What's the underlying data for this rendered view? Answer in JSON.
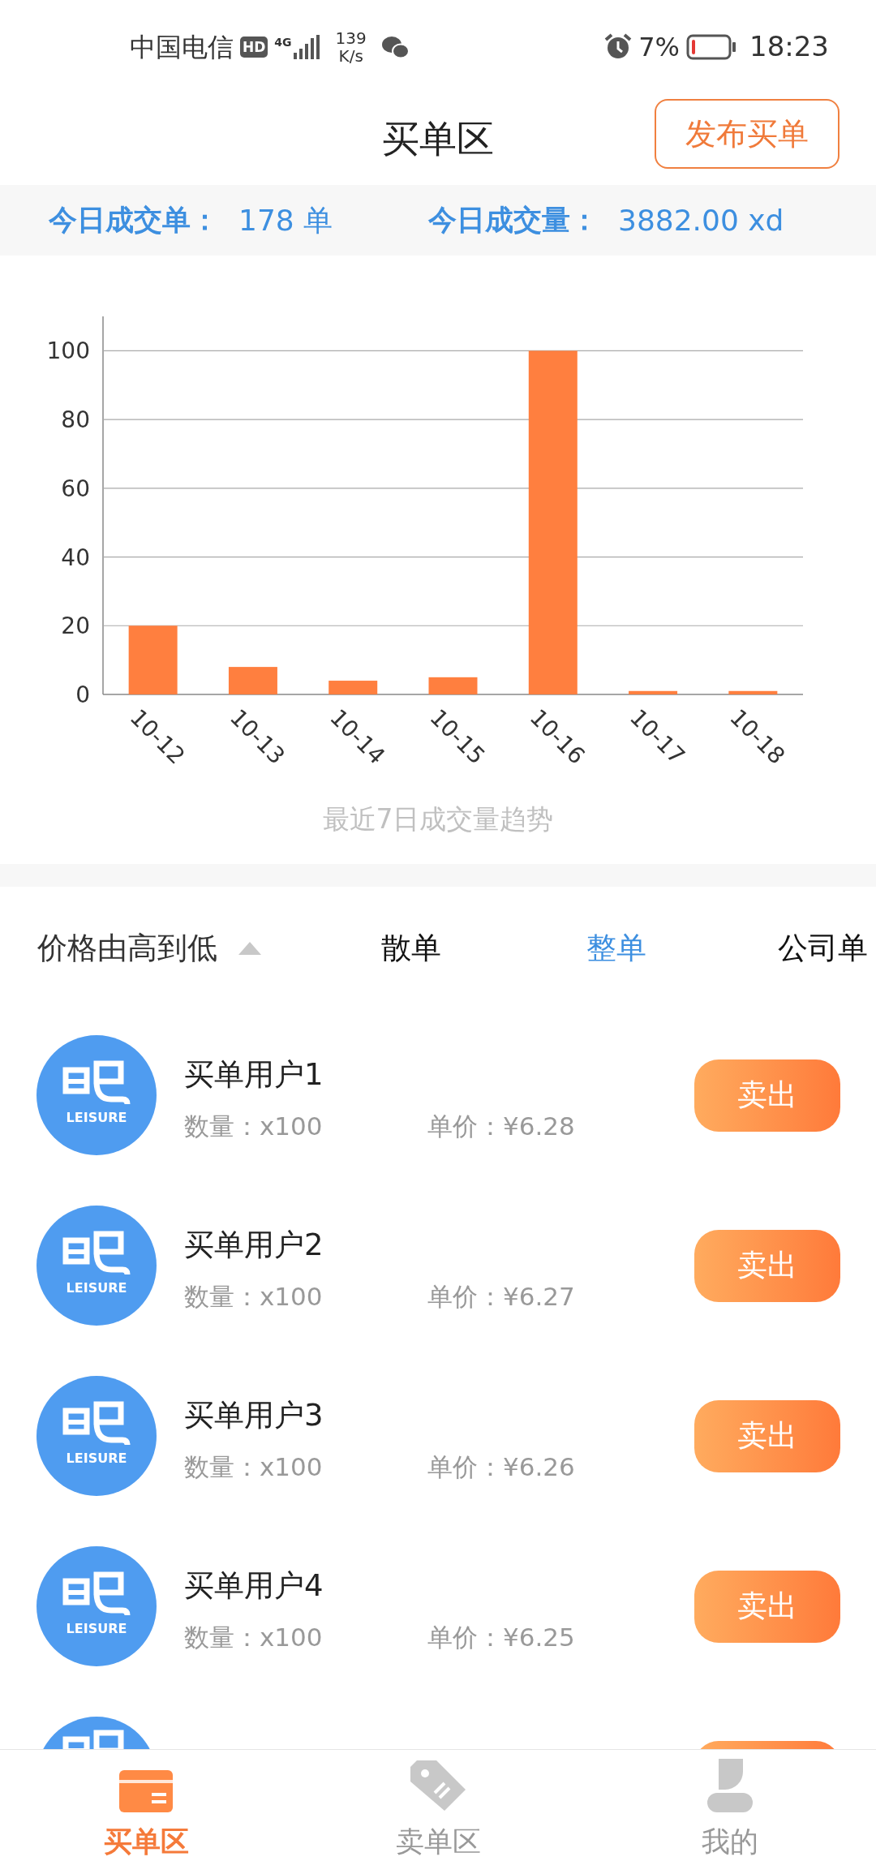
{
  "status_bar": {
    "carrier": "中国电信",
    "hd_badge": "HD",
    "network": "4G",
    "speed": "139",
    "speed_unit": "K/s",
    "battery": "7%",
    "time": "18:23"
  },
  "header": {
    "title": "买单区",
    "button": "发布买单"
  },
  "stats": [
    {
      "label": "今日成交单：",
      "value": "178 单"
    },
    {
      "label": "今日成交量：",
      "value": "3882.00 xd"
    }
  ],
  "chart_data": {
    "type": "bar",
    "title": "最近7日成交量趋势",
    "categories": [
      "10-12",
      "10-13",
      "10-14",
      "10-15",
      "10-16",
      "10-17",
      "10-18"
    ],
    "grid": true,
    "series": [
      {
        "color": "#ff7f3f",
        "values": [
          20,
          8,
          4,
          5,
          100,
          1,
          1
        ]
      }
    ],
    "ylim": [
      0,
      110
    ],
    "yticks": [
      0,
      20,
      40,
      60,
      80,
      100
    ]
  },
  "filters": [
    {
      "kind": "sort",
      "label": "价格由高到低",
      "selected": false
    },
    {
      "kind": "tab",
      "label": "散单",
      "selected": false
    },
    {
      "kind": "tab",
      "label": "整单",
      "selected": true
    },
    {
      "kind": "tab",
      "label": "公司单",
      "selected": false
    }
  ],
  "orders": [
    {
      "name": "买单用户1",
      "avatar_text": "LEISURE",
      "quantity": "数量：x100",
      "price": "单价：¥6.28",
      "action": "卖出"
    },
    {
      "name": "买单用户2",
      "avatar_text": "LEISURE",
      "quantity": "数量：x100",
      "price": "单价：¥6.27",
      "action": "卖出"
    },
    {
      "name": "买单用户3",
      "avatar_text": "LEISURE",
      "quantity": "数量：x100",
      "price": "单价：¥6.26",
      "action": "卖出"
    },
    {
      "name": "买单用户4",
      "avatar_text": "LEISURE",
      "quantity": "数量：x100",
      "price": "单价：¥6.25",
      "action": "卖出"
    },
    {
      "avatar_shown": true
    }
  ],
  "nav": [
    {
      "kind": "card",
      "label": "买单区",
      "selected": true
    },
    {
      "kind": "tag",
      "label": "卖单区",
      "selected": false
    },
    {
      "kind": "person",
      "label": "我的",
      "selected": false
    }
  ]
}
